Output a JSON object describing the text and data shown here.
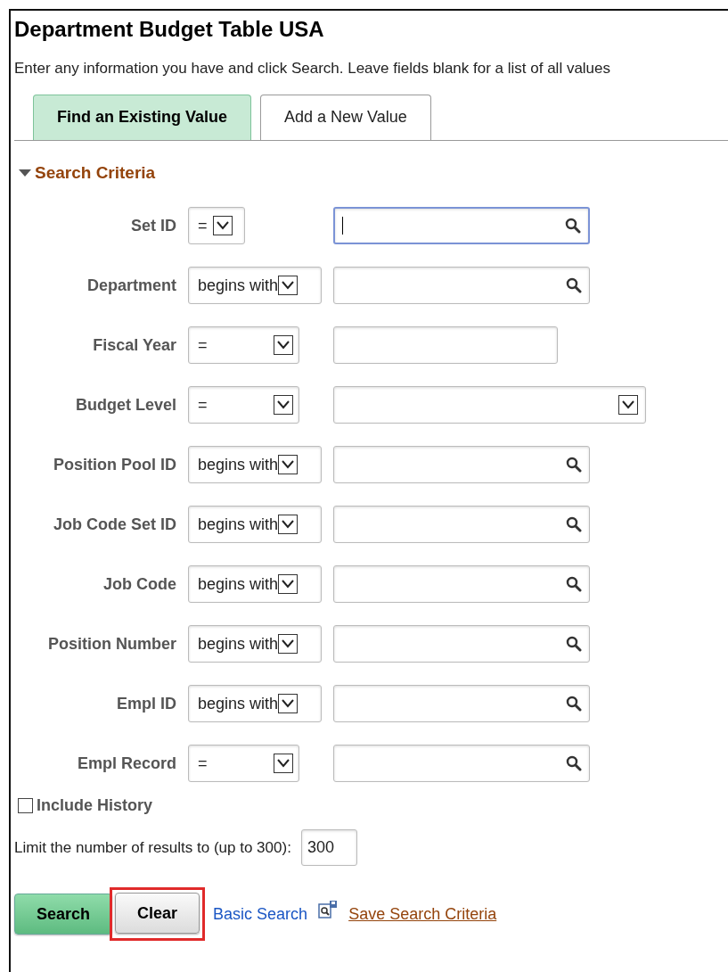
{
  "title": "Department Budget Table USA",
  "instructions": "Enter any information you have and click Search. Leave fields blank for a list of all values",
  "tabs": [
    {
      "label": "Find an Existing Value",
      "selected": true
    },
    {
      "label": "Add a New Value",
      "selected": false
    }
  ],
  "section": {
    "title": "Search Criteria",
    "expanded": true
  },
  "fields": [
    {
      "label": "Set ID",
      "operator": {
        "text": "=",
        "kind": "short"
      },
      "kind": "lookup",
      "focused": true
    },
    {
      "label": "Department",
      "operator": {
        "text": "begins with",
        "kind": "fit"
      },
      "kind": "lookup",
      "focused": false
    },
    {
      "label": "Fiscal Year",
      "operator": {
        "text": "=",
        "kind": "padded"
      },
      "kind": "text",
      "focused": false
    },
    {
      "label": "Budget Level",
      "operator": {
        "text": "=",
        "kind": "padded"
      },
      "kind": "dropdown",
      "focused": false
    },
    {
      "label": "Position Pool ID",
      "operator": {
        "text": "begins with",
        "kind": "fit"
      },
      "kind": "lookup",
      "focused": false
    },
    {
      "label": "Job Code Set ID",
      "operator": {
        "text": "begins with",
        "kind": "fit"
      },
      "kind": "lookup",
      "focused": false
    },
    {
      "label": "Job Code",
      "operator": {
        "text": "begins with",
        "kind": "fit"
      },
      "kind": "lookup",
      "focused": false
    },
    {
      "label": "Position Number",
      "operator": {
        "text": "begins with",
        "kind": "fit"
      },
      "kind": "lookup",
      "focused": false
    },
    {
      "label": "Empl ID",
      "operator": {
        "text": "begins with",
        "kind": "fit"
      },
      "kind": "lookup",
      "focused": false
    },
    {
      "label": "Empl Record",
      "operator": {
        "text": "=",
        "kind": "padded"
      },
      "kind": "lookup",
      "focused": false
    }
  ],
  "include_history": {
    "label": "Include History",
    "checked": false
  },
  "limit": {
    "label": "Limit the number of results to (up to 300):",
    "value": "300"
  },
  "buttons": [
    {
      "label": "Search",
      "kind": "primary",
      "highlighted": false
    },
    {
      "label": "Clear",
      "kind": "secondary",
      "highlighted": true
    }
  ],
  "links": [
    {
      "label": "Basic Search",
      "kind": "plain"
    },
    {
      "label": "Save Search Criteria",
      "kind": "save"
    }
  ]
}
